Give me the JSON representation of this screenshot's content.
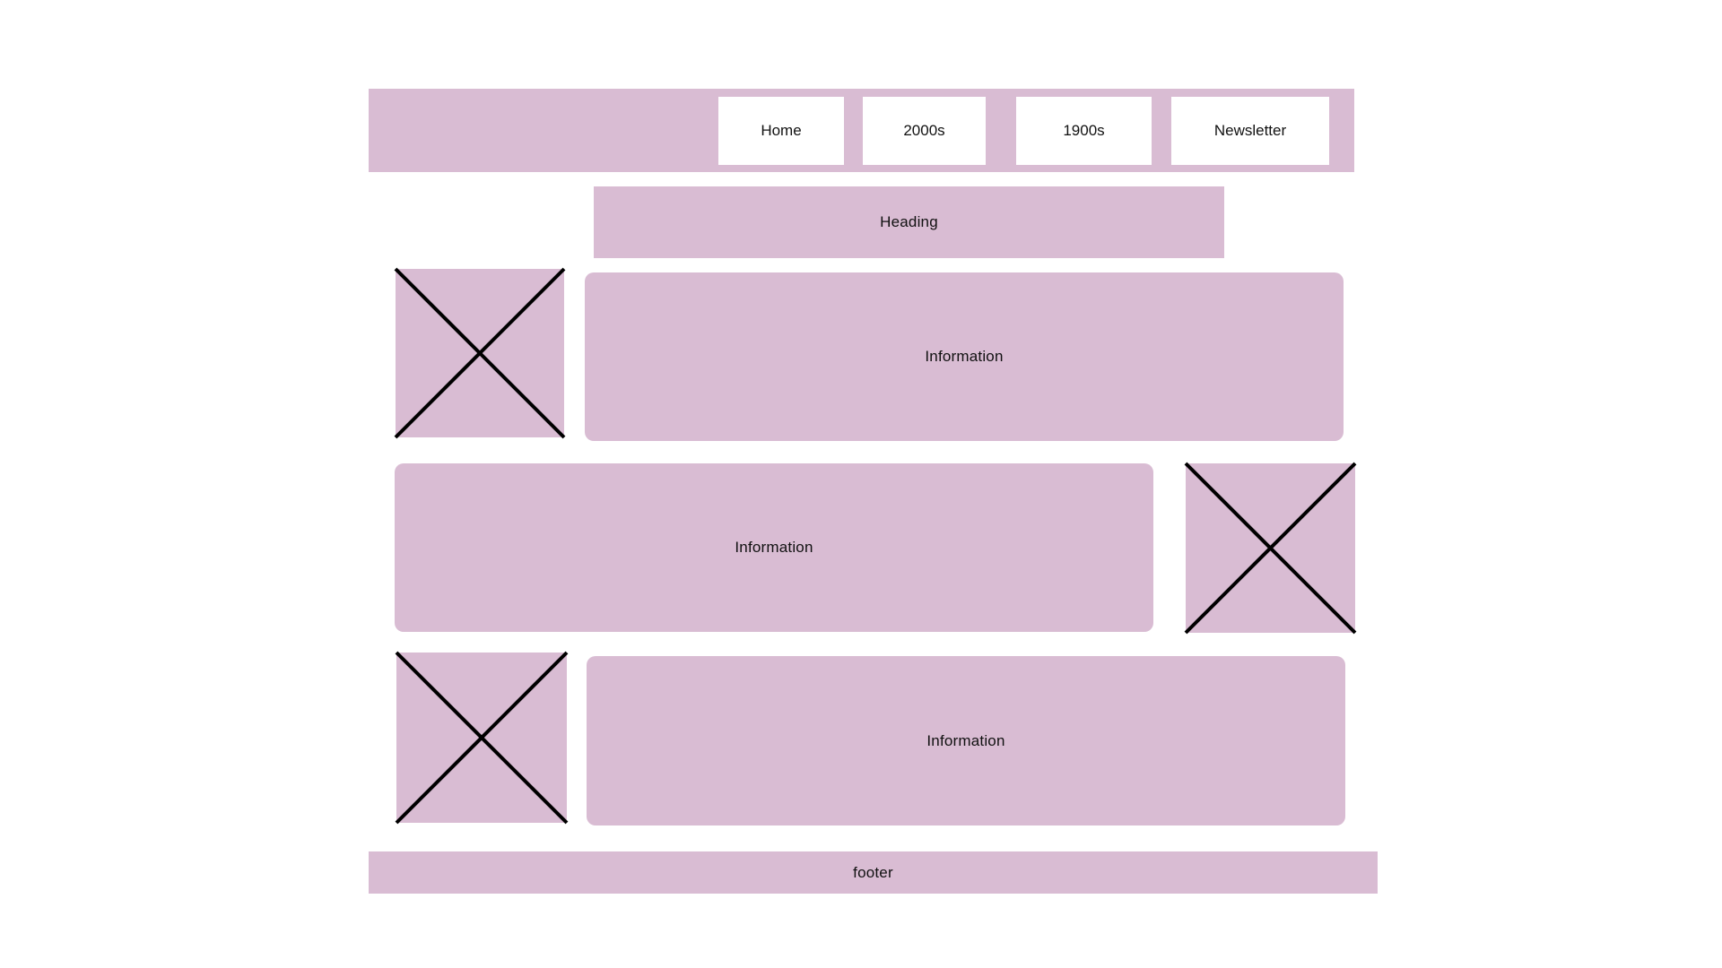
{
  "nav": {
    "items": [
      {
        "label": "Home"
      },
      {
        "label": "2000s"
      },
      {
        "label": "1900s"
      },
      {
        "label": "Newsletter"
      }
    ]
  },
  "heading": {
    "label": "Heading"
  },
  "sections": [
    {
      "label": "Information",
      "image_icon": "image-placeholder-icon"
    },
    {
      "label": "Information",
      "image_icon": "image-placeholder-icon"
    },
    {
      "label": "Information",
      "image_icon": "image-placeholder-icon"
    }
  ],
  "footer": {
    "label": "footer"
  },
  "colors": {
    "block": "#d9bcd3",
    "background": "#ffffff",
    "nav_button": "#ffffff",
    "stroke": "#000000"
  }
}
